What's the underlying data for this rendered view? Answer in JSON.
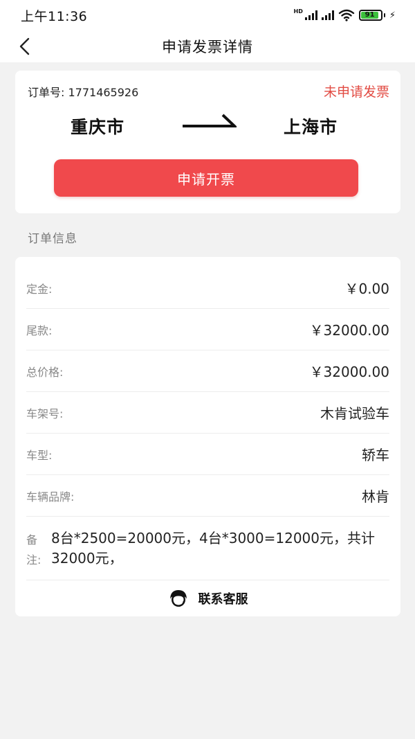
{
  "status_bar": {
    "time": "上午11:36",
    "network": "HD",
    "battery": "91"
  },
  "navbar": {
    "title": "申请发票详情"
  },
  "order": {
    "order_no_label": "订单号: 1771465926",
    "status": "未申请发票",
    "from_city": "重庆市",
    "to_city": "上海市",
    "apply_button": "申请开票"
  },
  "section": {
    "title": "订单信息"
  },
  "info": {
    "rows": [
      {
        "label": "定金:",
        "value": "￥0.00"
      },
      {
        "label": "尾款:",
        "value": "￥32000.00"
      },
      {
        "label": "总价格:",
        "value": "￥32000.00"
      },
      {
        "label": "车架号:",
        "value": "木肯试验车"
      },
      {
        "label": "车型:",
        "value": "轿车"
      },
      {
        "label": "车辆品牌:",
        "value": "林肯"
      }
    ],
    "note_label": "备注:",
    "note_text": "8台*2500=20000元，4台*3000=12000元，共计32000元，"
  },
  "contact": {
    "label": "联系客服"
  },
  "colors": {
    "accent": "#f0494c",
    "status_red": "#e24b43",
    "battery_green": "#3bbf3b"
  }
}
